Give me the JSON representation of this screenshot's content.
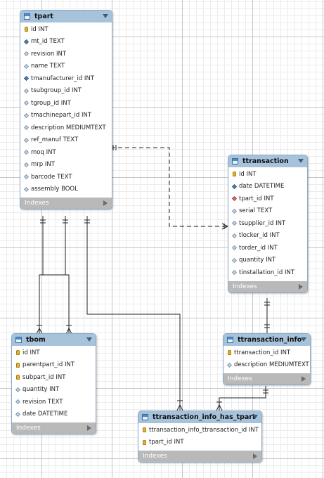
{
  "tables": {
    "tpart": {
      "name": "tpart",
      "indexes": "Indexes",
      "columns": [
        {
          "key": "pk",
          "text": "id INT"
        },
        {
          "key": "att-fill",
          "text": "mt_id TEXT"
        },
        {
          "key": "att",
          "text": "revision INT"
        },
        {
          "key": "att",
          "text": "name TEXT"
        },
        {
          "key": "att-fill",
          "text": "tmanufacturer_id INT"
        },
        {
          "key": "att",
          "text": "tsubgroup_id INT"
        },
        {
          "key": "att",
          "text": "tgroup_id INT"
        },
        {
          "key": "att",
          "text": "tmachinepart_id INT"
        },
        {
          "key": "att",
          "text": "description MEDIUMTEXT"
        },
        {
          "key": "att",
          "text": "ref_manuf TEXT"
        },
        {
          "key": "att",
          "text": "moq INT"
        },
        {
          "key": "att",
          "text": "mrp INT"
        },
        {
          "key": "att",
          "text": "barcode TEXT"
        },
        {
          "key": "att",
          "text": "assembly BOOL"
        }
      ]
    },
    "ttransaction": {
      "name": "ttransaction",
      "indexes": "Indexes",
      "columns": [
        {
          "key": "pk",
          "text": "id INT"
        },
        {
          "key": "att-fill",
          "text": "date DATETIME"
        },
        {
          "key": "fk",
          "text": "tpart_id INT"
        },
        {
          "key": "att",
          "text": "serial TEXT"
        },
        {
          "key": "att",
          "text": "tsupplier_id INT"
        },
        {
          "key": "att",
          "text": "tlocker_id INT"
        },
        {
          "key": "att",
          "text": "torder_id INT"
        },
        {
          "key": "att",
          "text": "quantity INT"
        },
        {
          "key": "att",
          "text": "tinstallation_id INT"
        }
      ]
    },
    "tbom": {
      "name": "tbom",
      "indexes": "Indexes",
      "columns": [
        {
          "key": "pk",
          "text": "id INT"
        },
        {
          "key": "pk",
          "text": "parentpart_id INT"
        },
        {
          "key": "pk",
          "text": "subpart_id INT"
        },
        {
          "key": "att",
          "text": "quantity INT"
        },
        {
          "key": "att",
          "text": "revision TEXT"
        },
        {
          "key": "att",
          "text": "date DATETIME"
        }
      ]
    },
    "ttransaction_info": {
      "name": "ttransaction_info",
      "indexes": "Indexes",
      "columns": [
        {
          "key": "pk",
          "text": "ttransaction_id INT"
        },
        {
          "key": "att",
          "text": "description MEDIUMTEXT"
        }
      ]
    },
    "ttransaction_info_has_tpart": {
      "name": "ttransaction_info_has_tpart",
      "indexes": "Indexes",
      "columns": [
        {
          "key": "pk",
          "text": "ttransaction_info_ttransaction_id INT"
        },
        {
          "key": "pk",
          "text": "tpart_id INT"
        }
      ]
    }
  },
  "colors": {
    "header": "#a7c3dc",
    "border": "#8ba9c6",
    "indexes_bar": "#b9b9b9",
    "connector": "#222222"
  },
  "relationships": [
    {
      "from": "tpart",
      "to": "ttransaction",
      "style": "dashed"
    },
    {
      "from": "tpart",
      "to": "tbom",
      "style": "solid"
    },
    {
      "from": "tpart",
      "to": "tbom",
      "style": "solid"
    },
    {
      "from": "tpart",
      "to": "ttransaction_info_has_tpart",
      "style": "solid"
    },
    {
      "from": "ttransaction",
      "to": "ttransaction_info",
      "style": "solid"
    },
    {
      "from": "ttransaction_info",
      "to": "ttransaction_info_has_tpart",
      "style": "solid"
    }
  ]
}
